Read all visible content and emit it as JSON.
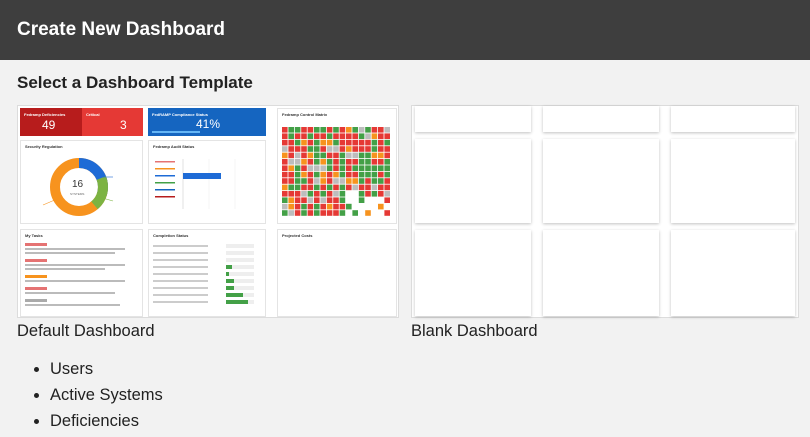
{
  "header": {
    "title": "Create New Dashboard"
  },
  "section": {
    "title": "Select a Dashboard Template"
  },
  "templates": [
    {
      "label": "Default Dashboard",
      "preview": {
        "deficiencies": {
          "title": "Fedramp Deficiencies",
          "value": "49",
          "critical_label": "Critical",
          "critical_value": "3"
        },
        "compliance": {
          "title": "FedRAMP Compliance Status",
          "value": "41%"
        },
        "control_matrix": {
          "title": "Fedramp Control Matrix"
        },
        "security_regulation": {
          "title": "Security Regulation",
          "center_value": "16",
          "center_label": "SYSTEMS"
        },
        "audit_status": {
          "title": "Fedramp Audit Status"
        },
        "my_tasks": {
          "title": "My Tasks"
        },
        "completion_status": {
          "title": "Completion Status"
        },
        "projected_costs": {
          "title": "Projected Costs"
        }
      }
    },
    {
      "label": "Blank Dashboard"
    }
  ],
  "features": [
    "Users",
    "Active Systems",
    "Deficiencies"
  ],
  "colors": {
    "header_bg": "#3e3e3e",
    "red": "#d32f2f",
    "blue": "#1565c0",
    "green": "#43a047",
    "orange": "#f7931e"
  }
}
